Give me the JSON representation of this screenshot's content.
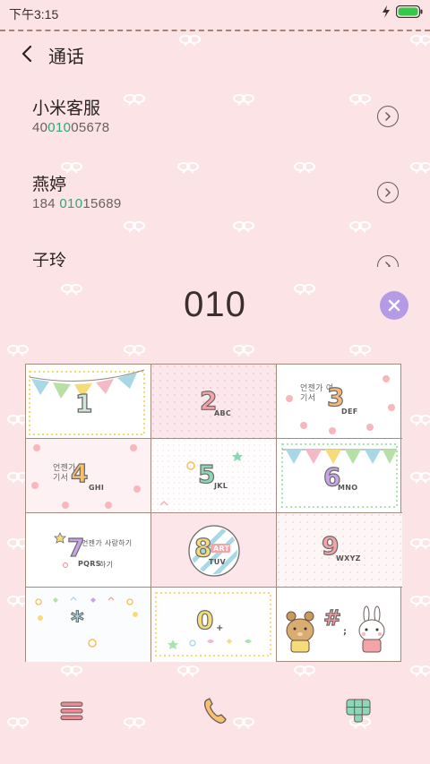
{
  "status": {
    "time": "下午3:15"
  },
  "header": {
    "title": "通话"
  },
  "contacts": [
    {
      "name": "小米客服",
      "number_pre": "40",
      "number_hl": "010",
      "number_post": "05678"
    },
    {
      "name": "燕婷",
      "number_pre": "184 ",
      "number_hl": "010",
      "number_post": "15689"
    },
    {
      "name": "子玲"
    }
  ],
  "dial": {
    "input": "010"
  },
  "keys": [
    {
      "digit": "1",
      "letters": ""
    },
    {
      "digit": "2",
      "letters": "ABC"
    },
    {
      "digit": "3",
      "letters": "DEF"
    },
    {
      "digit": "4",
      "letters": "GHI"
    },
    {
      "digit": "5",
      "letters": "JKL"
    },
    {
      "digit": "6",
      "letters": "MNO"
    },
    {
      "digit": "7",
      "letters": "PQRS"
    },
    {
      "digit": "8",
      "letters": "TUV"
    },
    {
      "digit": "9",
      "letters": "WXYZ"
    },
    {
      "digit": "*",
      "letters": ""
    },
    {
      "digit": "0",
      "letters": "+"
    },
    {
      "digit": "#",
      "letters": ";"
    }
  ],
  "key_deco": {
    "k3": "언젠가 여기서",
    "k4": "언젠가 여기서",
    "k7_top": "언젠가 사랑하기",
    "k7_bottom": "하기",
    "k8_badge": "ART"
  },
  "colors": {
    "accent": "#2ea872",
    "clear": "#b59be6",
    "background": "#fbe3e6"
  },
  "icons": [
    "back-arrow-icon",
    "chevron-right-icon",
    "clear-icon",
    "menu-icon",
    "phone-icon",
    "dialpad-icon",
    "battery-icon",
    "charging-icon"
  ]
}
